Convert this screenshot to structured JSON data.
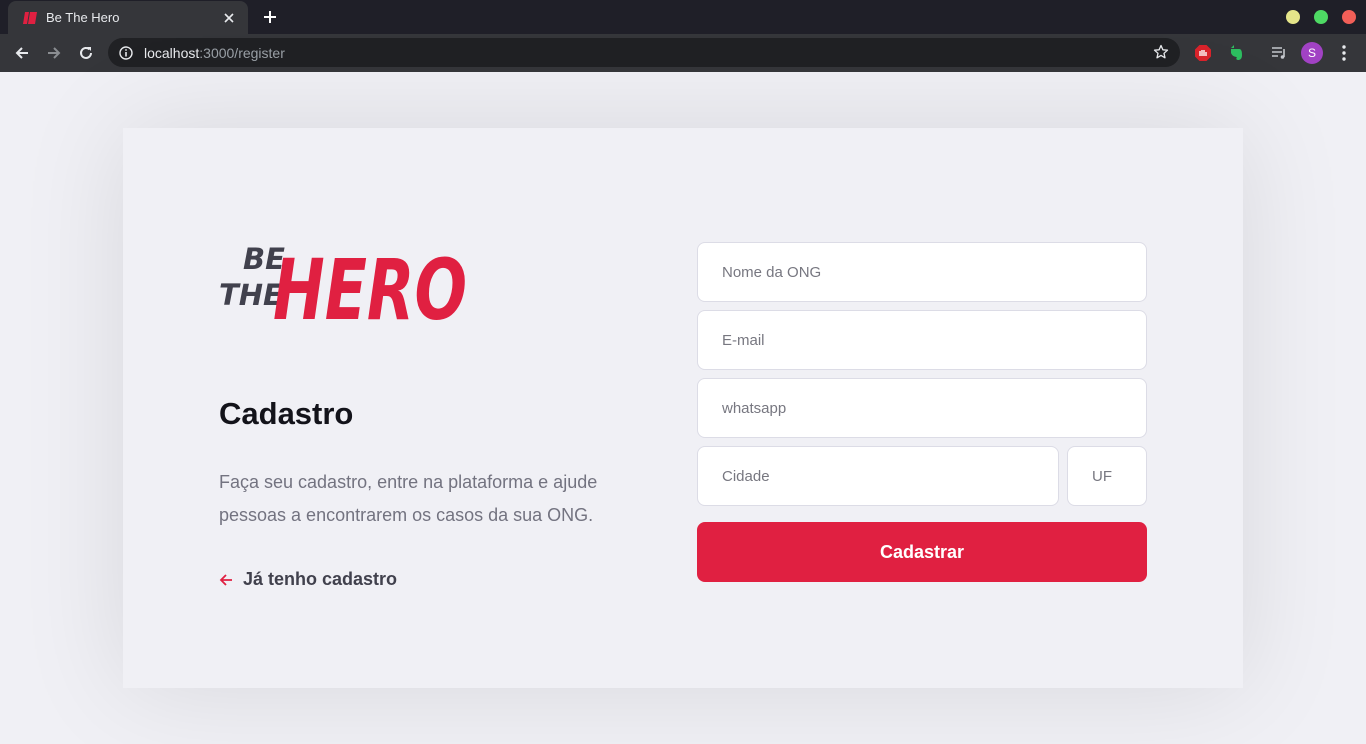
{
  "browser": {
    "tab_title": "Be The Hero",
    "url_host": "localhost",
    "url_rest": ":3000/register",
    "avatar_letter": "S",
    "colors": {
      "tabbar": "#1f1f28",
      "toolbar": "#35363a",
      "omnibox": "#202124"
    },
    "window_controls": [
      "#e5e58a",
      "#4ed964",
      "#f25f58"
    ]
  },
  "logo": {
    "line1": "BE",
    "line2": "THE",
    "word": "HERO",
    "color_dark": "#41414d",
    "color_accent": "#e02041"
  },
  "register": {
    "title": "Cadastro",
    "description": "Faça seu cadastro, entre na plataforma e ajude pessoas a encontrarem os casos da sua ONG.",
    "back_link": "Já tenho cadastro"
  },
  "form": {
    "name_placeholder": "Nome da ONG",
    "email_placeholder": "E-mail",
    "whatsapp_placeholder": "whatsapp",
    "city_placeholder": "Cidade",
    "uf_placeholder": "UF",
    "submit_label": "Cadastrar"
  },
  "colors": {
    "accent": "#e02041",
    "background": "#f0f0f5",
    "text_dark": "#13131a",
    "text_muted": "#737380"
  }
}
